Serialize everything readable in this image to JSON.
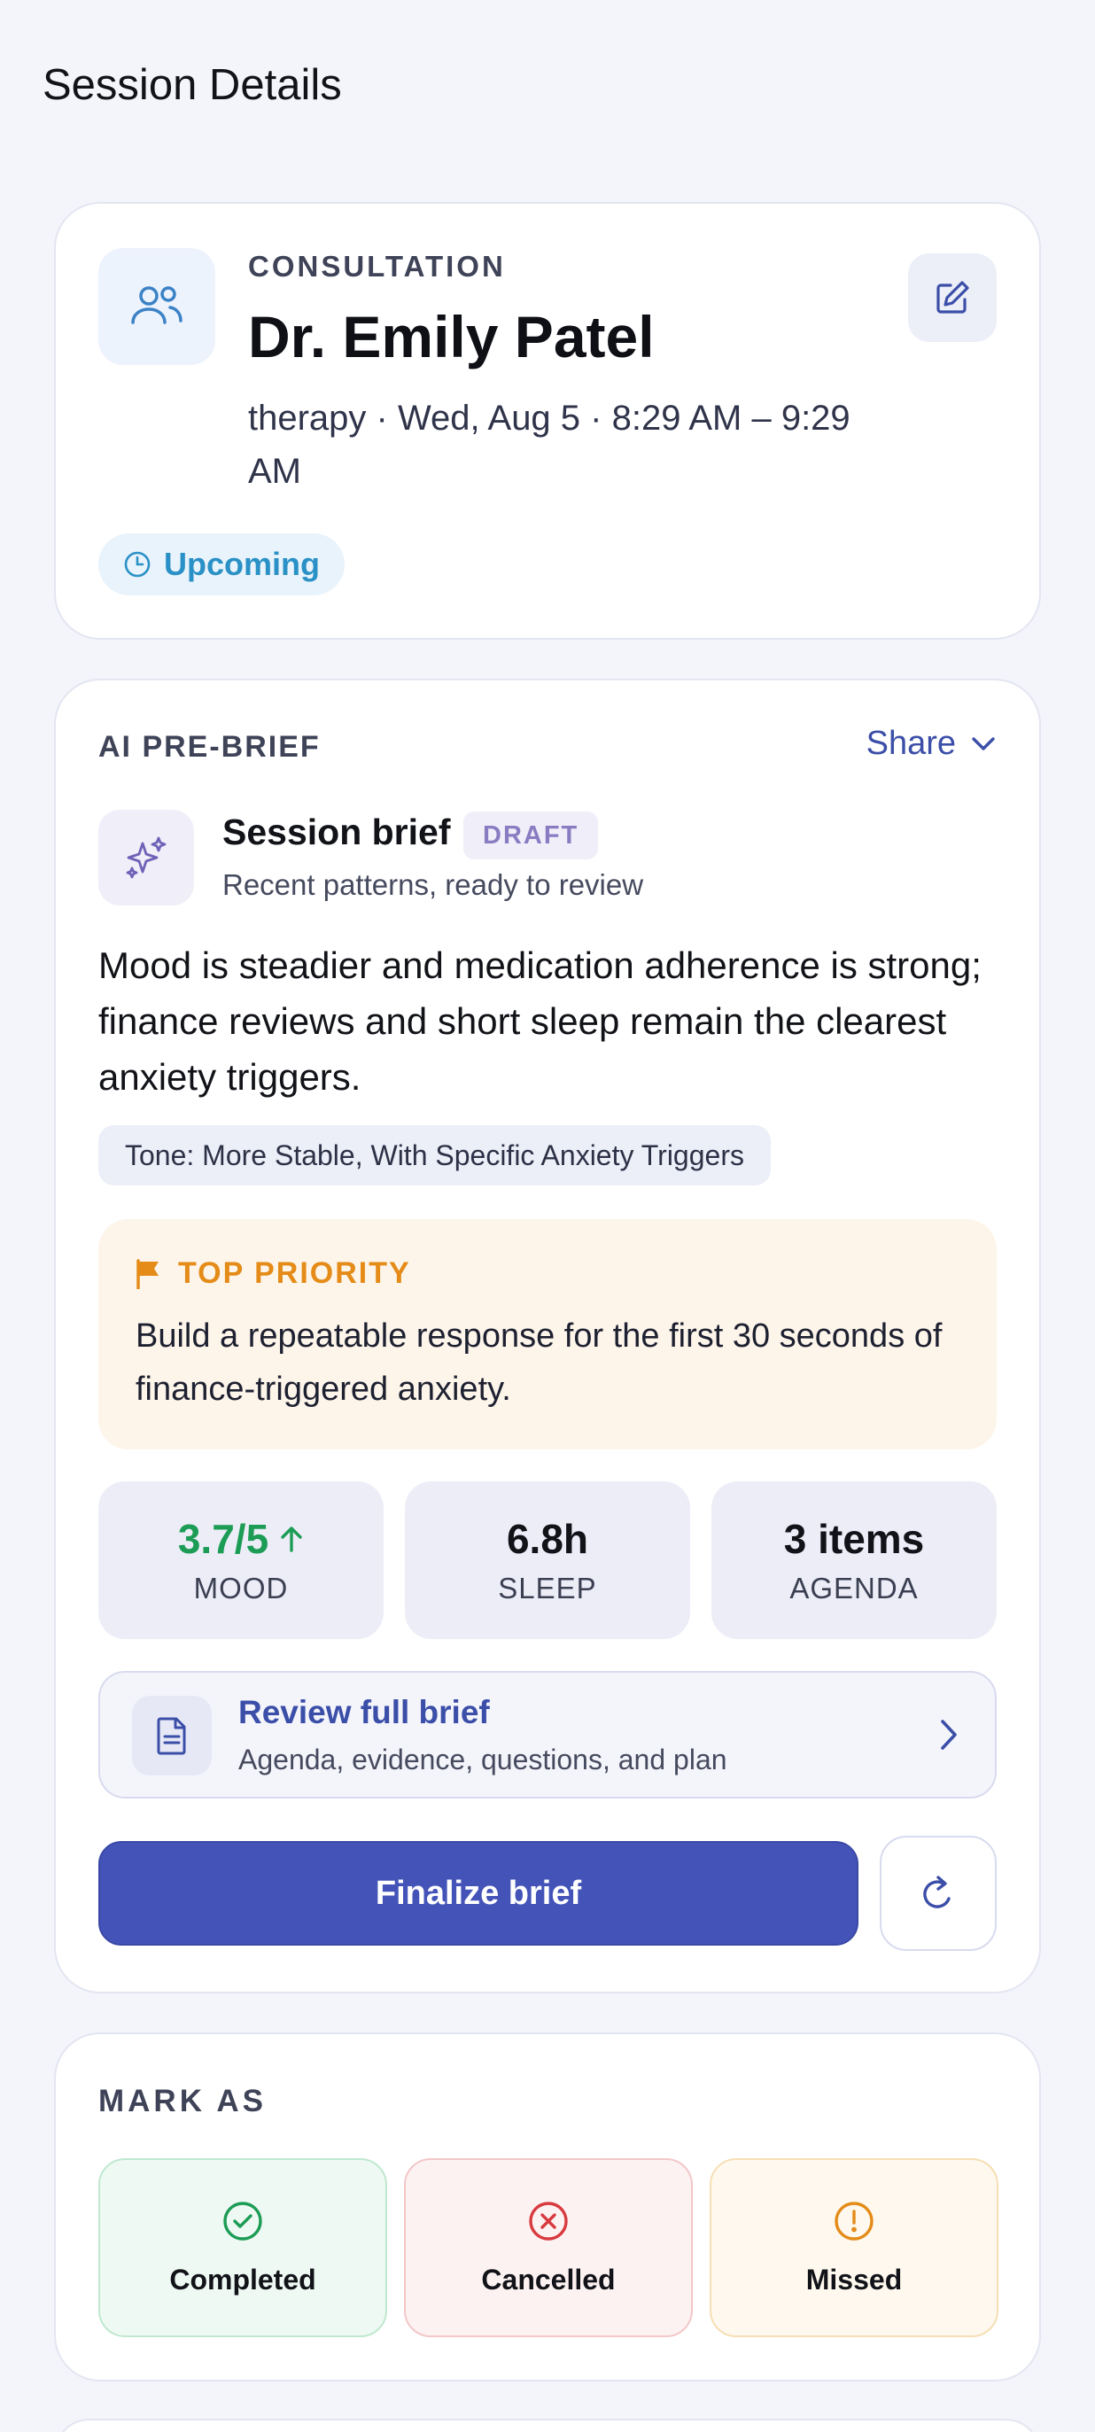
{
  "page": {
    "title": "Session Details"
  },
  "session": {
    "type_label": "CONSULTATION",
    "provider_name": "Dr. Emily Patel",
    "when": "therapy · Wed, Aug 5 · 8:29 AM – 9:29 AM",
    "status": "Upcoming",
    "icons": {
      "avatar": "people-icon",
      "edit": "edit-icon",
      "status": "clock-icon"
    }
  },
  "brief": {
    "section_label": "AI PRE-BRIEF",
    "share_label": "Share",
    "title": "Session brief",
    "badge": "DRAFT",
    "subtitle": "Recent patterns, ready to review",
    "summary": "Mood is steadier and medication adherence is strong; finance reviews and short sleep remain the clearest anxiety triggers.",
    "tone": "Tone: More Stable, With Specific Anxiety Triggers",
    "priority": {
      "label": "TOP PRIORITY",
      "text": "Build a repeatable response for the first 30 seconds of finance-triggered anxiety."
    },
    "stats": [
      {
        "value": "3.7/5",
        "label": "MOOD",
        "trend": "up"
      },
      {
        "value": "6.8h",
        "label": "SLEEP"
      },
      {
        "value": "3 items",
        "label": "AGENDA"
      }
    ],
    "review": {
      "title": "Review full brief",
      "subtitle": "Agenda, evidence, questions, and plan"
    },
    "finalize_label": "Finalize brief"
  },
  "mark_as": {
    "label": "MARK AS",
    "options": [
      {
        "label": "Completed",
        "icon": "check-circle-icon",
        "color": "#1c9c55"
      },
      {
        "label": "Cancelled",
        "icon": "x-circle-icon",
        "color": "#d83a3f"
      },
      {
        "label": "Missed",
        "icon": "alert-circle-icon",
        "color": "#e48b18"
      }
    ]
  },
  "colors": {
    "accent": "#4453b8",
    "link": "#3b4ea8",
    "status_upcoming": "#2a91c6",
    "priority": "#e48b18",
    "positive": "#1c9c55"
  }
}
